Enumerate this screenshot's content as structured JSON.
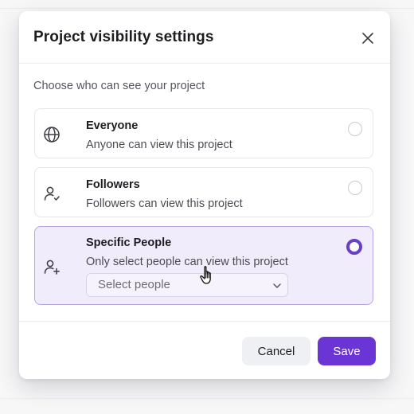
{
  "dialog": {
    "title": "Project visibility settings",
    "subtitle": "Choose who can see your project",
    "options": [
      {
        "title": "Everyone",
        "description": "Anyone can view this project",
        "icon": "globe-icon",
        "selected": false
      },
      {
        "title": "Followers",
        "description": "Followers can view this project",
        "icon": "user-check-icon",
        "selected": false
      },
      {
        "title": "Specific People",
        "description": "Only select people can view this project",
        "icon": "user-add-icon",
        "selected": true
      }
    ],
    "select_people": {
      "placeholder": "Select people"
    },
    "buttons": {
      "cancel": "Cancel",
      "save": "Save"
    }
  },
  "colors": {
    "accent": "#6b35d6",
    "selected_bg": "#f1ecfb",
    "selected_border": "#b7a6e2"
  }
}
